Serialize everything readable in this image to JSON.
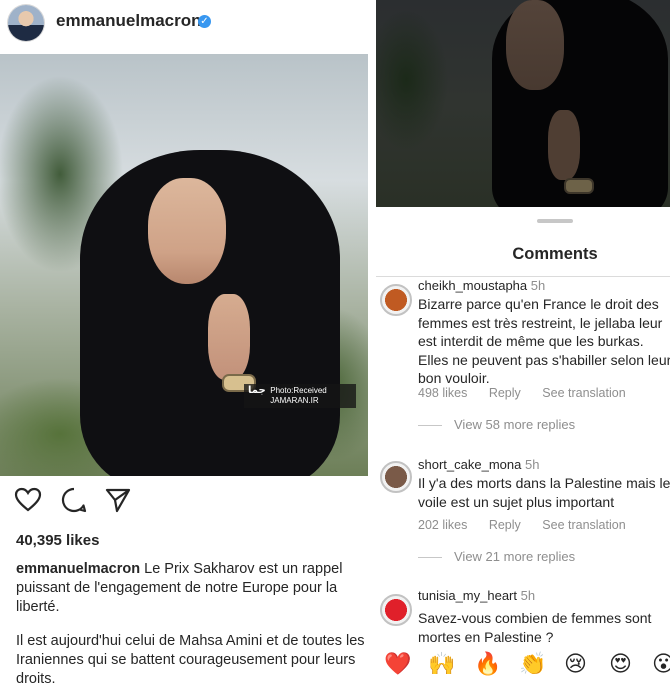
{
  "post": {
    "username": "emmanuelmacron",
    "verified_glyph": "✓",
    "photo_credit": {
      "logo_text": "جما",
      "line1": "Photo:Received",
      "line2": "JAMARAN.IR"
    },
    "likes": "40,395 likes",
    "caption_user": "emmanuelmacron",
    "caption_text": " Le Prix Sakharov est un rappel puissant de l'engagement de notre Europe pour la liberté.",
    "caption_p2": "Il est aujourd'hui celui de Mahsa Amini et de toutes les Iraniennes qui se battent courageusement pour leurs droits.",
    "icons": [
      "heart-icon",
      "comment-icon",
      "share-icon"
    ]
  },
  "comments_sheet": {
    "title": "Comments",
    "comments": [
      {
        "user": "cheikh_moustapha",
        "time": "5h",
        "lines": [
          "Bizarre parce qu'en France le droit des",
          "femmes est très restreint, le jellaba leur",
          "est interdit de même que les burkas.",
          "Elles ne peuvent pas s'habiller selon leur",
          "bon vouloir."
        ],
        "likes": "498 likes",
        "reply": "Reply",
        "translate": "See translation",
        "view_replies": "View 58 more replies",
        "avatar_color": "#c05a22"
      },
      {
        "user": "short_cake_mona",
        "time": "5h",
        "lines": [
          "Il y'a des morts dans la Palestine mais le",
          "voile est un sujet plus important"
        ],
        "likes": "202 likes",
        "reply": "Reply",
        "translate": "See translation",
        "view_replies": "View 21 more replies",
        "avatar_color": "#7a5a48"
      },
      {
        "user": "tunisia_my_heart",
        "time": "5h",
        "lines": [
          "Savez-vous combien de femmes sont",
          "mortes en Palestine ?"
        ],
        "avatar_color": "#e0202a"
      }
    ],
    "emojis": [
      "❤️",
      "🙌",
      "🔥",
      "👏",
      "😢",
      "😍",
      "😮"
    ]
  }
}
